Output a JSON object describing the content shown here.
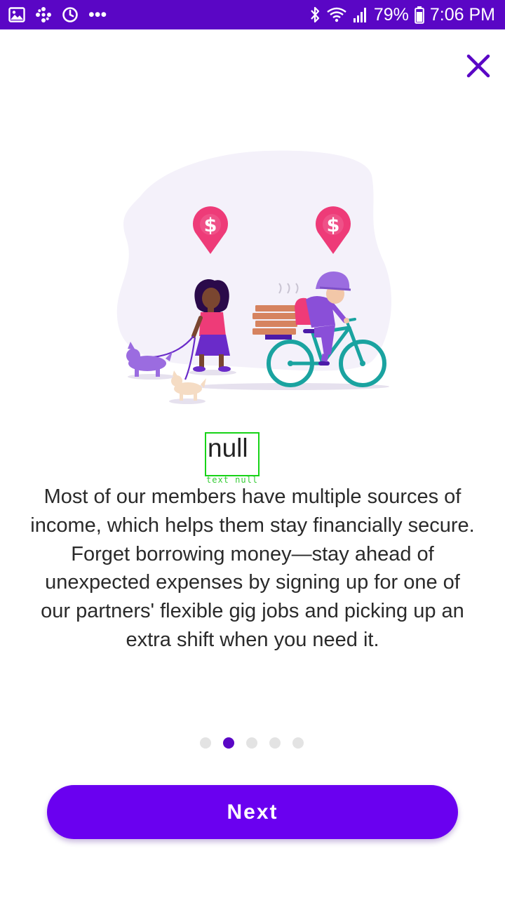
{
  "status_bar": {
    "battery": "79%",
    "time": "7:06 PM",
    "more": "•••",
    "left_icons": [
      "image-icon",
      "pinwheel-icon",
      "sync-icon",
      "more-icon"
    ],
    "right_icons": [
      "bluetooth-icon",
      "wifi-icon",
      "signal-icon",
      "battery-icon"
    ],
    "color": "#5a06c5"
  },
  "close": {
    "icon": "close-icon",
    "color": "#5a06c5"
  },
  "illustration": {
    "icons": [
      "dollar-pin-icon",
      "dollar-pin-icon"
    ],
    "pin_label": "$",
    "accent": "#ee3b78"
  },
  "slide": {
    "title": "null",
    "debug_label": "text null",
    "body": "Most of our members have multiple sources of income, which helps them stay financially secure. Forget borrowing money—stay ahead of unexpected expenses by signing up for one of our partners' flexible gig jobs and picking up an extra shift when you need it."
  },
  "pagination": {
    "total": 5,
    "active": 2
  },
  "next_button": {
    "label": "Next",
    "color": "#6a00f0"
  }
}
